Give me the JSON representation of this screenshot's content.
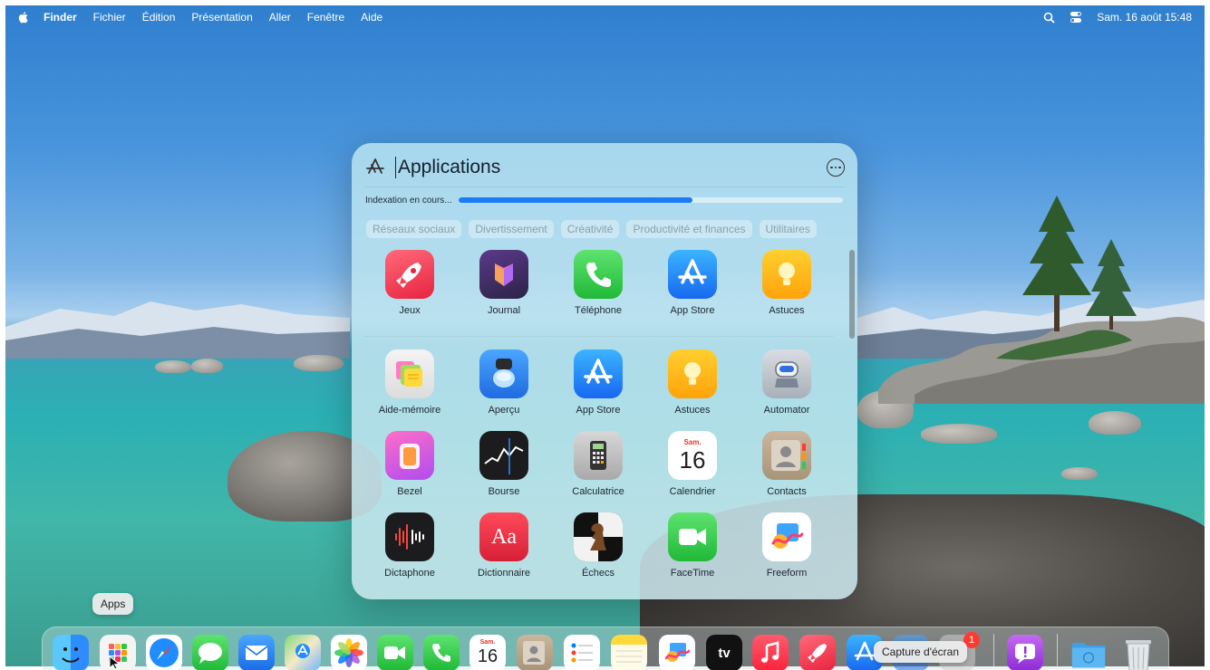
{
  "menubar": {
    "items": [
      "Finder",
      "Fichier",
      "Édition",
      "Présentation",
      "Aller",
      "Fenêtre",
      "Aide"
    ],
    "clock": "Sam. 16 août 15:48"
  },
  "panel": {
    "title": "Applications",
    "indexing_label": "Indexation en cours...",
    "indexing_progress": 0.61,
    "categories": [
      "Réseaux sociaux",
      "Divertissement",
      "Créativité",
      "Productivité et finances",
      "Utilitaires"
    ],
    "featured": [
      {
        "label": "Jeux",
        "icon": "games-rocket-icon"
      },
      {
        "label": "Journal",
        "icon": "journal-icon"
      },
      {
        "label": "Téléphone",
        "icon": "phone-icon"
      },
      {
        "label": "App Store",
        "icon": "app-store-icon"
      },
      {
        "label": "Astuces",
        "icon": "tips-lightbulb-icon"
      }
    ],
    "apps_row1": [
      {
        "label": "Aide-mémoire",
        "icon": "stickies-icon"
      },
      {
        "label": "Aperçu",
        "icon": "preview-icon"
      },
      {
        "label": "App Store",
        "icon": "app-store-icon"
      },
      {
        "label": "Astuces",
        "icon": "tips-lightbulb-icon"
      },
      {
        "label": "Automator",
        "icon": "automator-icon"
      }
    ],
    "apps_row2": [
      {
        "label": "Bezel",
        "icon": "bezel-icon"
      },
      {
        "label": "Bourse",
        "icon": "stocks-icon"
      },
      {
        "label": "Calculatrice",
        "icon": "calculator-icon"
      },
      {
        "label": "Calendrier",
        "icon": "calendar-icon",
        "day": "Sam.",
        "date": "16"
      },
      {
        "label": "Contacts",
        "icon": "contacts-icon"
      }
    ],
    "apps_row3": [
      {
        "label": "Dictaphone",
        "icon": "voice-memos-icon"
      },
      {
        "label": "Dictionnaire",
        "icon": "dictionary-icon",
        "glyph": "Aa"
      },
      {
        "label": "Échecs",
        "icon": "chess-icon"
      },
      {
        "label": "FaceTime",
        "icon": "facetime-icon"
      },
      {
        "label": "Freeform",
        "icon": "freeform-icon"
      }
    ]
  },
  "dock": {
    "tooltip_apps": "Apps",
    "tooltip_screenshot": "Capture d'écran",
    "calendar_date": "16",
    "calendar_day": "Sam.",
    "tv_label": "tv",
    "mail_badge": "1",
    "items": [
      "finder-icon",
      "launchpad-apps-icon",
      "safari-icon",
      "messages-icon",
      "mail-icon",
      "maps-icon",
      "photos-icon",
      "facetime-icon",
      "phone-icon",
      "calendar-icon",
      "contacts-icon",
      "reminders-icon",
      "notes-icon",
      "freeform-icon",
      "apple-tv-icon",
      "music-icon",
      "games-rocket-icon",
      "app-store-icon",
      "preview-icon",
      "badged-app-icon",
      "feedback-icon",
      "downloads-folder-icon",
      "trash-icon"
    ]
  }
}
